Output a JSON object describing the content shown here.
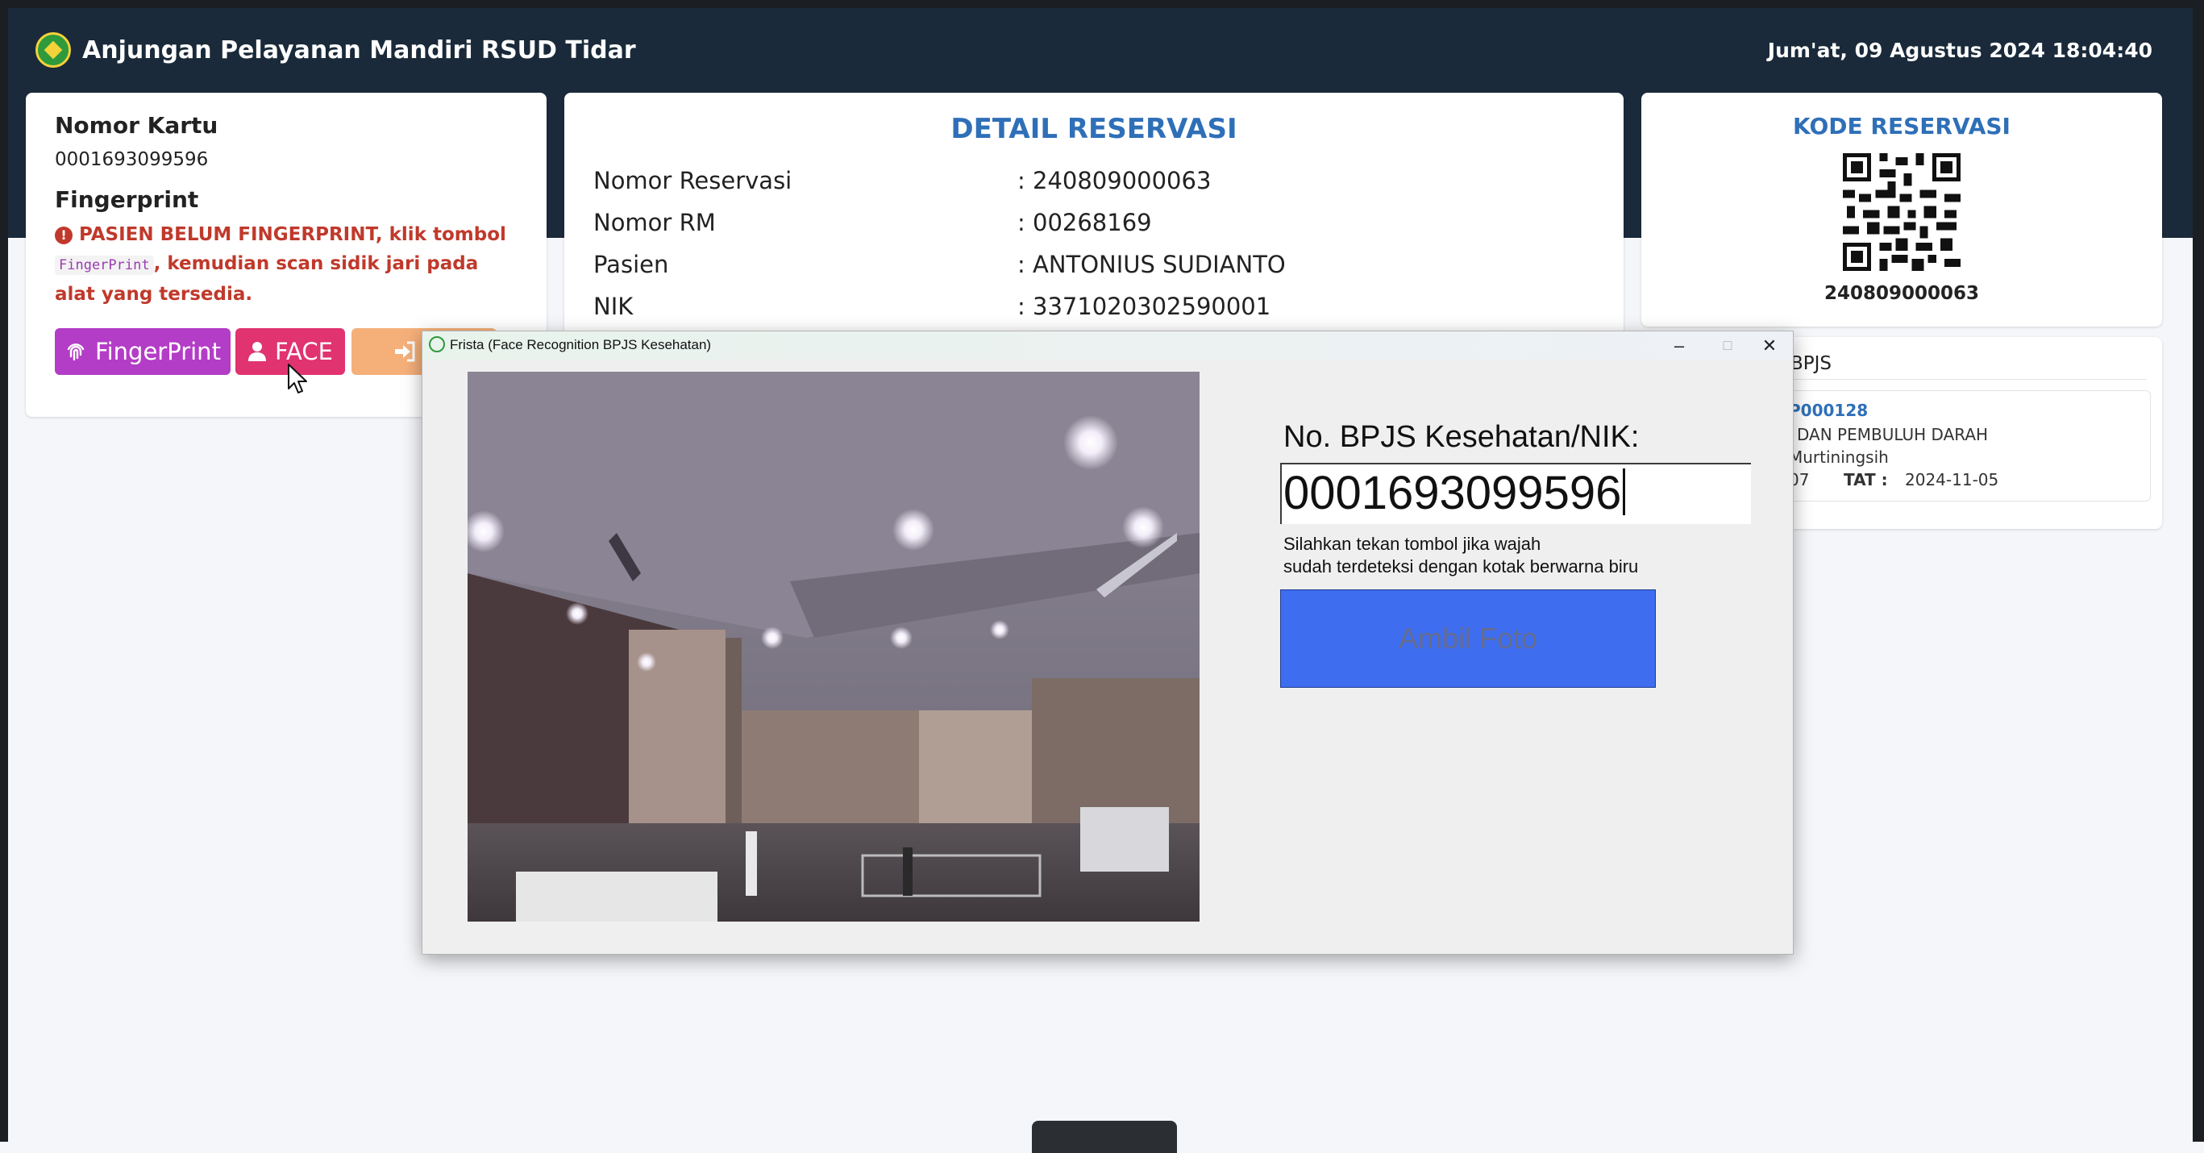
{
  "header": {
    "app_title": "Anjungan Pelayanan Mandiri RSUD Tidar",
    "datetime": "Jum'at, 09 Agustus 2024 18:04:40"
  },
  "patient_card": {
    "card_label": "Nomor Kartu",
    "card_number": "0001693099596",
    "fingerprint_label": "Fingerprint",
    "warning_prefix": "PASIEN BELUM FINGERPRINT, klik tombol",
    "warning_code": "FingerPrint",
    "warning_suffix": ", kemudian scan sidik jari pada alat yang tersedia.",
    "buttons": {
      "fingerprint": "FingerPrint",
      "face": "FACE",
      "checkin": "Ch"
    }
  },
  "reservation": {
    "title": "DETAIL RESERVASI",
    "rows": [
      {
        "label": "Nomor Reservasi",
        "value": ": 240809000063"
      },
      {
        "label": "Nomor RM",
        "value": ": 00268169"
      },
      {
        "label": "Pasien",
        "value": ": ANTONIUS SUDIANTO"
      },
      {
        "label": "NIK",
        "value": ": 3371020302590001"
      }
    ]
  },
  "kode": {
    "title": "KODE RESERVASI",
    "number": "240809000063"
  },
  "bpjs": {
    "header": "BPJS",
    "item": {
      "code": "P000128",
      "desc": "DAN PEMBULUH DARAH",
      "doctor": "Murtiningsih",
      "date_partial": "07",
      "tat_label": "TAT :",
      "tat_value": "2024-11-05"
    }
  },
  "dialog": {
    "title": "Frista (Face Recognition BPJS Kesehatan)",
    "minimize": "–",
    "maximize": "□",
    "close": "✕",
    "nik_label": "No. BPJS Kesehatan/NIK:",
    "nik_value": "0001693099596",
    "hint_line1": "Silahkan tekan tombol jika wajah",
    "hint_line2": "sudah terdeteksi dengan kotak berwarna biru",
    "button_label": "Ambil Foto"
  },
  "colors": {
    "topbar": "#1a2a3a",
    "accent_blue": "#2f6fb8",
    "warning_red": "#c0392b",
    "fingerprint_btn": "#b33dc6",
    "face_btn": "#e0336f",
    "checkin_btn": "#f5b07a",
    "ambil_btn": "#3f6df0"
  }
}
